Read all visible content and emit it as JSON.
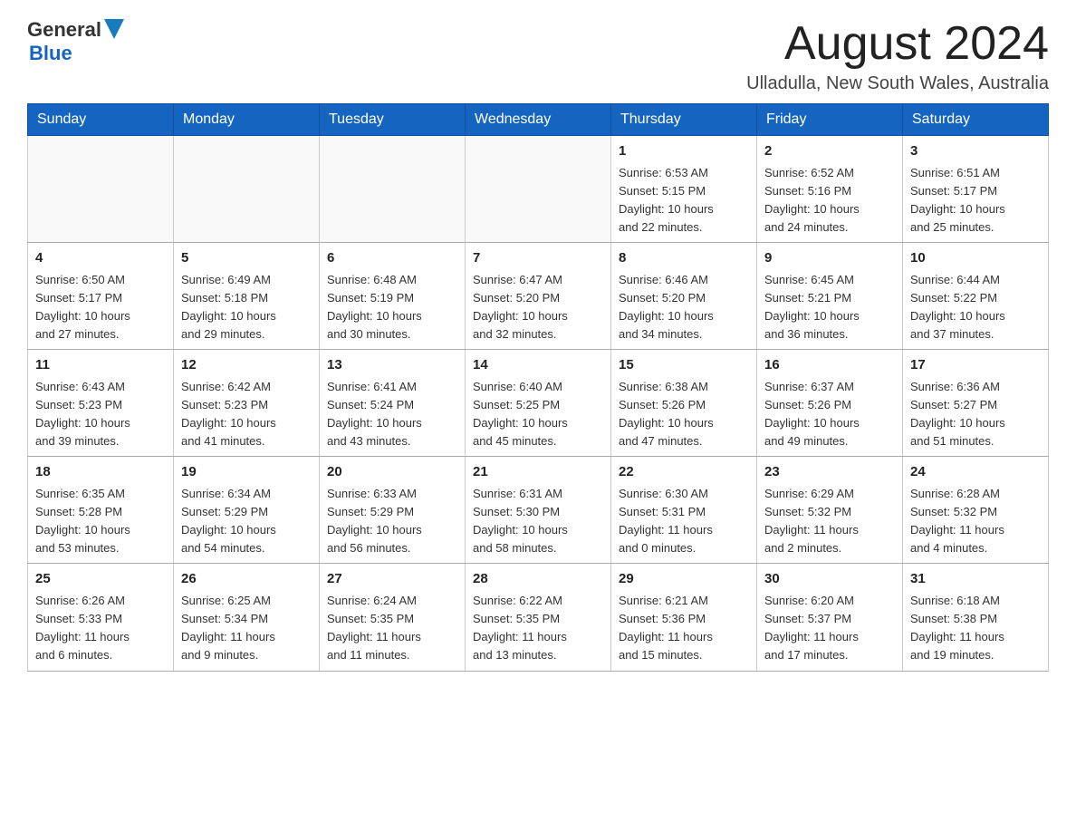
{
  "header": {
    "logo": {
      "general": "General",
      "blue": "Blue"
    },
    "month_title": "August 2024",
    "location": "Ulladulla, New South Wales, Australia"
  },
  "weekdays": [
    "Sunday",
    "Monday",
    "Tuesday",
    "Wednesday",
    "Thursday",
    "Friday",
    "Saturday"
  ],
  "weeks": [
    [
      {
        "day": "",
        "info": ""
      },
      {
        "day": "",
        "info": ""
      },
      {
        "day": "",
        "info": ""
      },
      {
        "day": "",
        "info": ""
      },
      {
        "day": "1",
        "info": "Sunrise: 6:53 AM\nSunset: 5:15 PM\nDaylight: 10 hours\nand 22 minutes."
      },
      {
        "day": "2",
        "info": "Sunrise: 6:52 AM\nSunset: 5:16 PM\nDaylight: 10 hours\nand 24 minutes."
      },
      {
        "day": "3",
        "info": "Sunrise: 6:51 AM\nSunset: 5:17 PM\nDaylight: 10 hours\nand 25 minutes."
      }
    ],
    [
      {
        "day": "4",
        "info": "Sunrise: 6:50 AM\nSunset: 5:17 PM\nDaylight: 10 hours\nand 27 minutes."
      },
      {
        "day": "5",
        "info": "Sunrise: 6:49 AM\nSunset: 5:18 PM\nDaylight: 10 hours\nand 29 minutes."
      },
      {
        "day": "6",
        "info": "Sunrise: 6:48 AM\nSunset: 5:19 PM\nDaylight: 10 hours\nand 30 minutes."
      },
      {
        "day": "7",
        "info": "Sunrise: 6:47 AM\nSunset: 5:20 PM\nDaylight: 10 hours\nand 32 minutes."
      },
      {
        "day": "8",
        "info": "Sunrise: 6:46 AM\nSunset: 5:20 PM\nDaylight: 10 hours\nand 34 minutes."
      },
      {
        "day": "9",
        "info": "Sunrise: 6:45 AM\nSunset: 5:21 PM\nDaylight: 10 hours\nand 36 minutes."
      },
      {
        "day": "10",
        "info": "Sunrise: 6:44 AM\nSunset: 5:22 PM\nDaylight: 10 hours\nand 37 minutes."
      }
    ],
    [
      {
        "day": "11",
        "info": "Sunrise: 6:43 AM\nSunset: 5:23 PM\nDaylight: 10 hours\nand 39 minutes."
      },
      {
        "day": "12",
        "info": "Sunrise: 6:42 AM\nSunset: 5:23 PM\nDaylight: 10 hours\nand 41 minutes."
      },
      {
        "day": "13",
        "info": "Sunrise: 6:41 AM\nSunset: 5:24 PM\nDaylight: 10 hours\nand 43 minutes."
      },
      {
        "day": "14",
        "info": "Sunrise: 6:40 AM\nSunset: 5:25 PM\nDaylight: 10 hours\nand 45 minutes."
      },
      {
        "day": "15",
        "info": "Sunrise: 6:38 AM\nSunset: 5:26 PM\nDaylight: 10 hours\nand 47 minutes."
      },
      {
        "day": "16",
        "info": "Sunrise: 6:37 AM\nSunset: 5:26 PM\nDaylight: 10 hours\nand 49 minutes."
      },
      {
        "day": "17",
        "info": "Sunrise: 6:36 AM\nSunset: 5:27 PM\nDaylight: 10 hours\nand 51 minutes."
      }
    ],
    [
      {
        "day": "18",
        "info": "Sunrise: 6:35 AM\nSunset: 5:28 PM\nDaylight: 10 hours\nand 53 minutes."
      },
      {
        "day": "19",
        "info": "Sunrise: 6:34 AM\nSunset: 5:29 PM\nDaylight: 10 hours\nand 54 minutes."
      },
      {
        "day": "20",
        "info": "Sunrise: 6:33 AM\nSunset: 5:29 PM\nDaylight: 10 hours\nand 56 minutes."
      },
      {
        "day": "21",
        "info": "Sunrise: 6:31 AM\nSunset: 5:30 PM\nDaylight: 10 hours\nand 58 minutes."
      },
      {
        "day": "22",
        "info": "Sunrise: 6:30 AM\nSunset: 5:31 PM\nDaylight: 11 hours\nand 0 minutes."
      },
      {
        "day": "23",
        "info": "Sunrise: 6:29 AM\nSunset: 5:32 PM\nDaylight: 11 hours\nand 2 minutes."
      },
      {
        "day": "24",
        "info": "Sunrise: 6:28 AM\nSunset: 5:32 PM\nDaylight: 11 hours\nand 4 minutes."
      }
    ],
    [
      {
        "day": "25",
        "info": "Sunrise: 6:26 AM\nSunset: 5:33 PM\nDaylight: 11 hours\nand 6 minutes."
      },
      {
        "day": "26",
        "info": "Sunrise: 6:25 AM\nSunset: 5:34 PM\nDaylight: 11 hours\nand 9 minutes."
      },
      {
        "day": "27",
        "info": "Sunrise: 6:24 AM\nSunset: 5:35 PM\nDaylight: 11 hours\nand 11 minutes."
      },
      {
        "day": "28",
        "info": "Sunrise: 6:22 AM\nSunset: 5:35 PM\nDaylight: 11 hours\nand 13 minutes."
      },
      {
        "day": "29",
        "info": "Sunrise: 6:21 AM\nSunset: 5:36 PM\nDaylight: 11 hours\nand 15 minutes."
      },
      {
        "day": "30",
        "info": "Sunrise: 6:20 AM\nSunset: 5:37 PM\nDaylight: 11 hours\nand 17 minutes."
      },
      {
        "day": "31",
        "info": "Sunrise: 6:18 AM\nSunset: 5:38 PM\nDaylight: 11 hours\nand 19 minutes."
      }
    ]
  ]
}
